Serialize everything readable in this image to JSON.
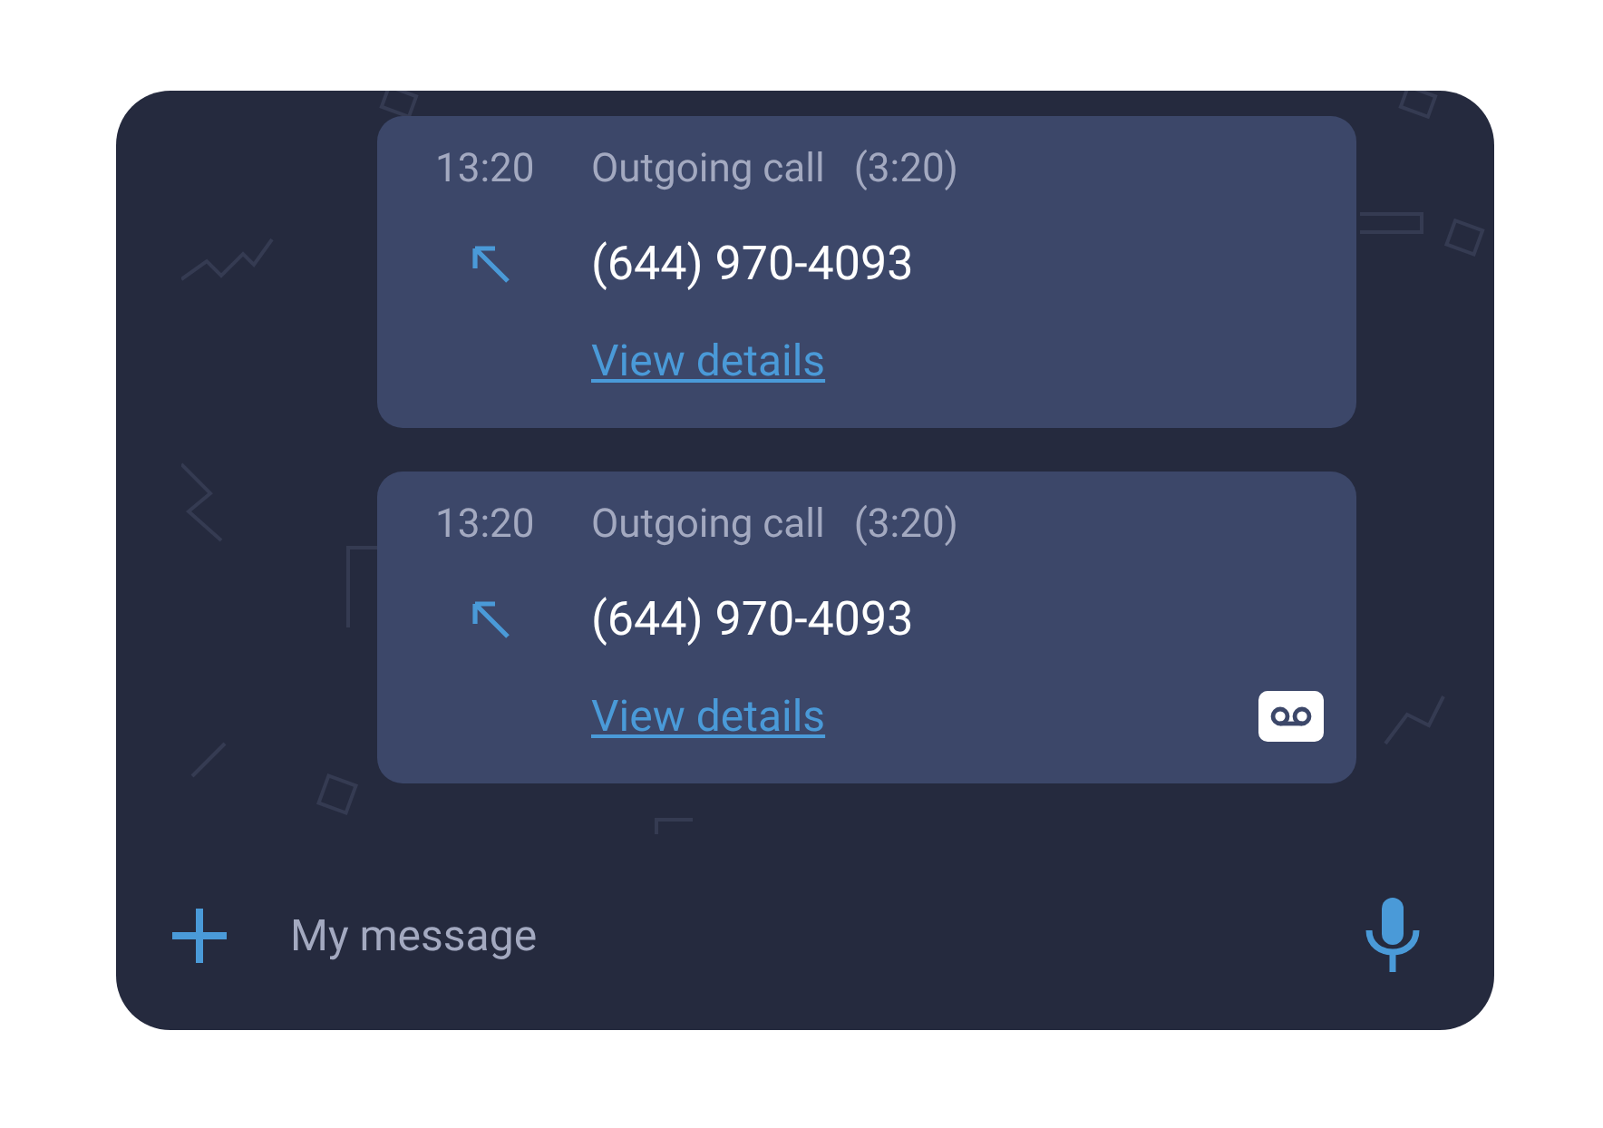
{
  "calls": [
    {
      "time": "13:20",
      "label": "Outgoing call",
      "duration": "(3:20)",
      "number": "(644) 970-4093",
      "link": "View details",
      "voicemail": false
    },
    {
      "time": "13:20",
      "label": "Outgoing call",
      "duration": "(3:20)",
      "number": "(644) 970-4093",
      "link": "View details",
      "voicemail": true
    }
  ],
  "composer": {
    "placeholder": "My message"
  }
}
